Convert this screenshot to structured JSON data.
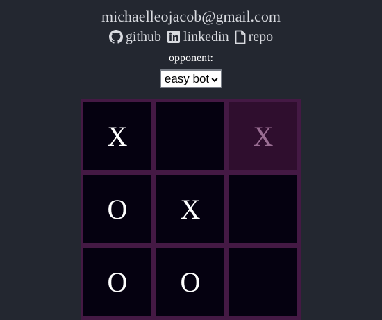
{
  "header": {
    "email": "michaelleojacob@gmail.com",
    "links": [
      {
        "label": "github",
        "icon": "github-icon"
      },
      {
        "label": "linkedin",
        "icon": "linkedin-icon"
      },
      {
        "label": "repo",
        "icon": "file-icon"
      }
    ]
  },
  "opponent": {
    "label": "opponent:",
    "selected": "easy bot"
  },
  "board": {
    "cells": [
      "X",
      "",
      "X",
      "O",
      "X",
      "",
      "O",
      "O",
      ""
    ],
    "hover_cell_index": 2
  },
  "colors": {
    "background": "#232730",
    "board_border": "#441944",
    "cell": "#050110",
    "hover_cell": "#2f0e2e",
    "mark": "#ffffff",
    "hover_mark": "#9a6e93"
  }
}
